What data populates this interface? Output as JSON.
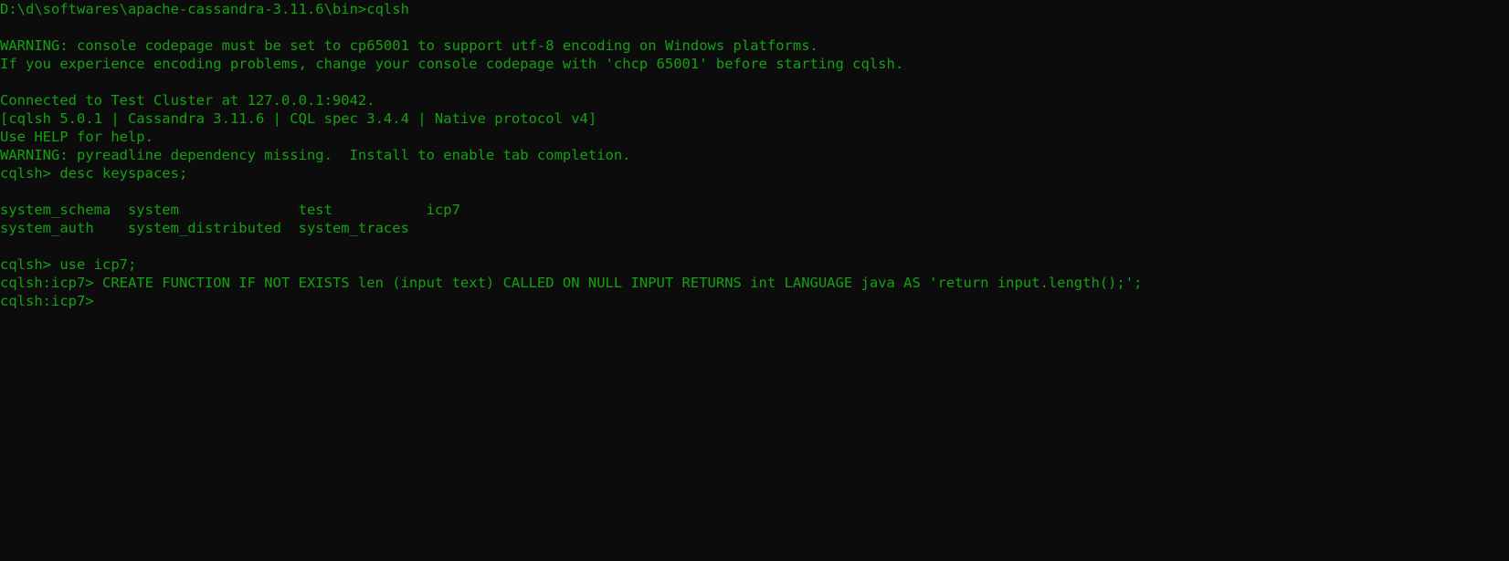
{
  "terminal": {
    "text_color": "#13a10e",
    "background_color": "#0c0c0c",
    "lines": [
      "D:\\d\\softwares\\apache-cassandra-3.11.6\\bin>cqlsh",
      "",
      "WARNING: console codepage must be set to cp65001 to support utf-8 encoding on Windows platforms.",
      "If you experience encoding problems, change your console codepage with 'chcp 65001' before starting cqlsh.",
      "",
      "Connected to Test Cluster at 127.0.0.1:9042.",
      "[cqlsh 5.0.1 | Cassandra 3.11.6 | CQL spec 3.4.4 | Native protocol v4]",
      "Use HELP for help.",
      "WARNING: pyreadline dependency missing.  Install to enable tab completion.",
      "cqlsh> desc keyspaces;",
      "",
      "system_schema  system              test           icp7",
      "system_auth    system_distributed  system_traces",
      "",
      "cqlsh> use icp7;",
      "cqlsh:icp7> CREATE FUNCTION IF NOT EXISTS len (input text) CALLED ON NULL INPUT RETURNS int LANGUAGE java AS 'return input.length();';",
      "cqlsh:icp7>"
    ]
  }
}
